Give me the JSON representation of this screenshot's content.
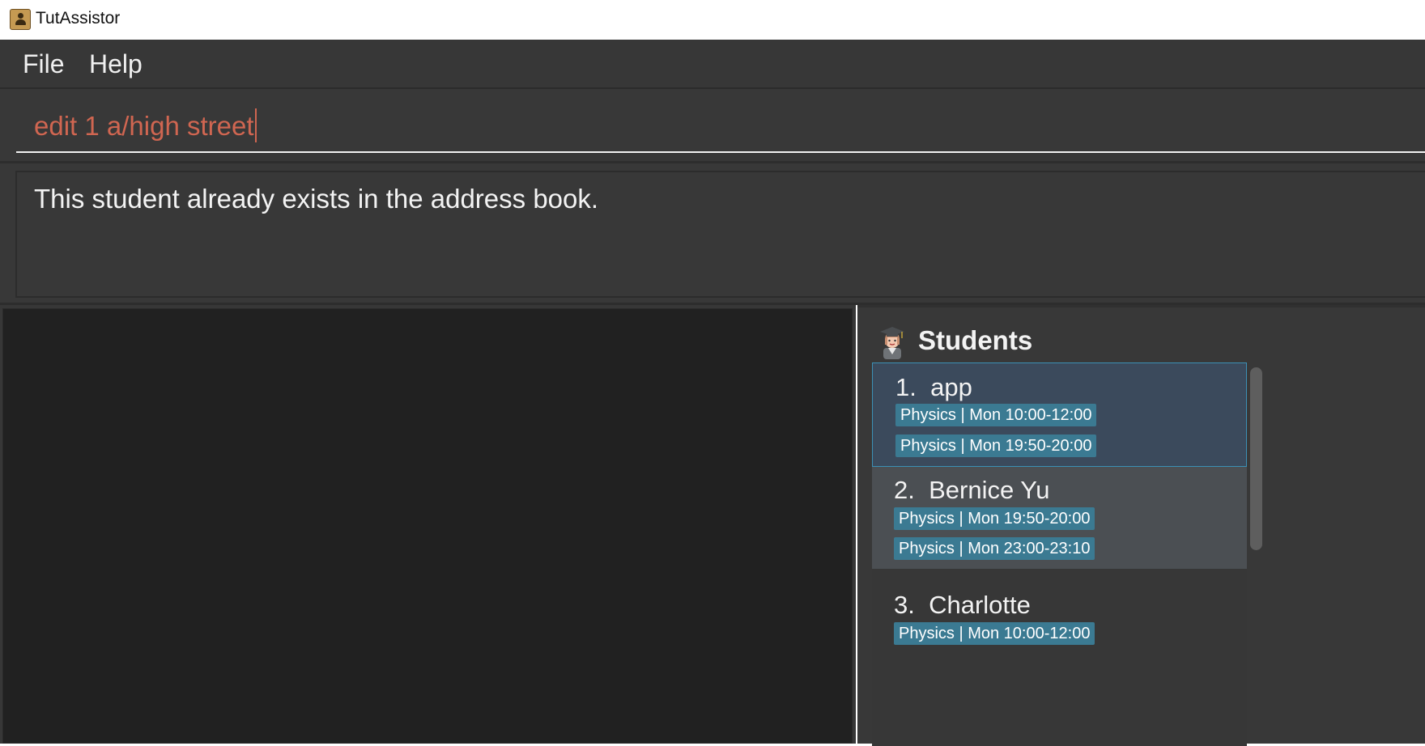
{
  "window": {
    "title": "TutAssistor"
  },
  "menu": {
    "file": "File",
    "help": "Help"
  },
  "command": {
    "value": "edit 1 a/high street"
  },
  "result": {
    "message": "This student already exists in the address book."
  },
  "students": {
    "title": "Students",
    "icon": "student-graduate-icon",
    "items": [
      {
        "index": "1.",
        "name": "app",
        "tags": [
          "Physics | Mon 10:00-12:00",
          "Physics | Mon 19:50-20:00"
        ]
      },
      {
        "index": "2.",
        "name": "Bernice Yu",
        "tags": [
          "Physics | Mon 19:50-20:00",
          "Physics | Mon 23:00-23:10"
        ]
      },
      {
        "index": "3.",
        "name": "Charlotte",
        "tags": [
          "Physics | Mon 10:00-12:00"
        ]
      }
    ]
  },
  "colors": {
    "command_text": "#d06651",
    "tag_background": "#3b7a92",
    "selected_border": "#3b90b5"
  }
}
